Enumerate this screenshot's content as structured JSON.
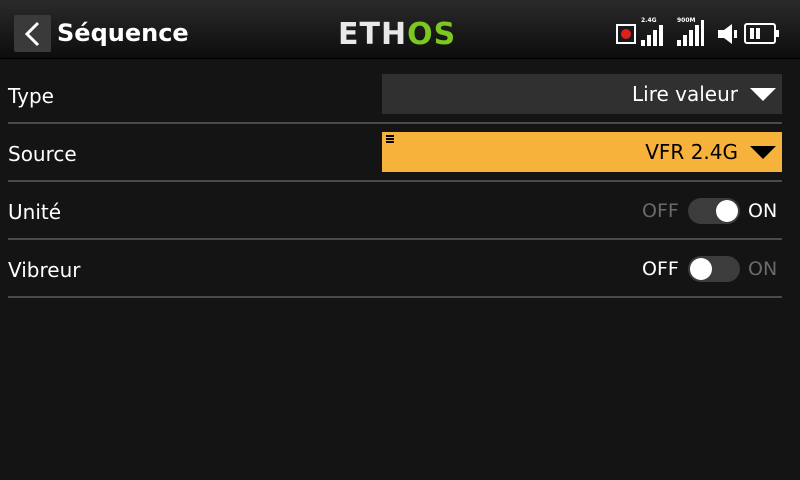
{
  "header": {
    "title": "Séquence",
    "logo_main": "ETH",
    "logo_accent": "OS",
    "signal_1_label": "2.4G",
    "signal_2_label": "900M",
    "icons": [
      "back-icon",
      "record-icon",
      "signal-icon",
      "speaker-icon",
      "battery-icon"
    ]
  },
  "rows": [
    {
      "label": "Type",
      "value": "Lire valeur"
    },
    {
      "label": "Source",
      "value": "VFR 2.4G"
    },
    {
      "label": "Unité",
      "off_label": "OFF",
      "on_label": "ON",
      "state": true
    },
    {
      "label": "Vibreur",
      "off_label": "OFF",
      "on_label": "ON",
      "state": false
    }
  ],
  "colors": {
    "background": "#141414",
    "accent": "#f7b23b",
    "logo_green": "#7cc820",
    "record": "#e0201a"
  }
}
